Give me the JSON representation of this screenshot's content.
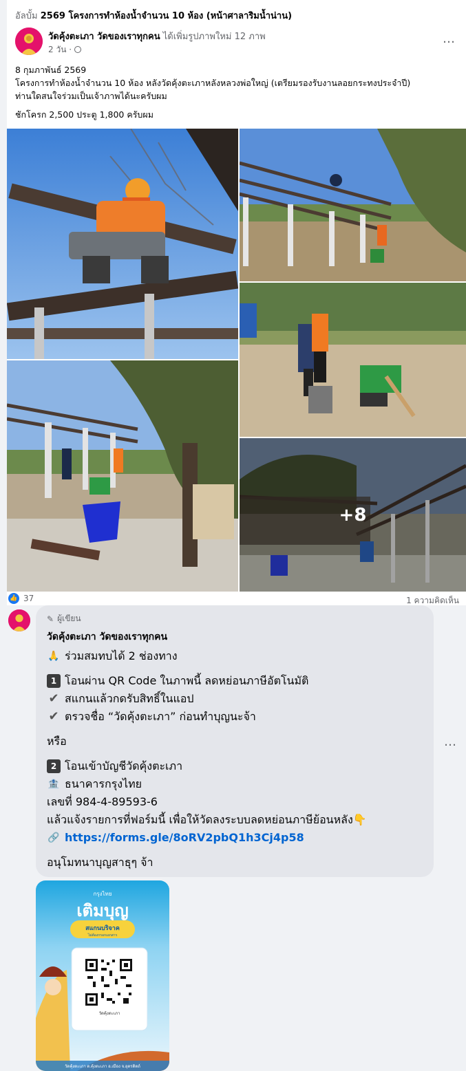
{
  "post": {
    "album_prefix": "อัลบั้ม",
    "album_title": "2569 โครงการทำห้องน้ำจำนวน 10 ห้อง (หน้าศาลาริมน้ำน่าน)",
    "author": "วัดคุ้งตะเภา วัดของเราทุกคน",
    "action": "ได้เพิ่มรูปภาพใหม่ 12 ภาพ",
    "time": "2 วัน ·",
    "more_icon": "…",
    "date_line": "8 กุมภาพันธ์ 2569",
    "line1": "โครงการทำห้องน้ำจำนวน 10 ห้อง หลังวัดคุ้งตะเภาหลังหลวงพ่อใหญ่ (เตรียมรองรับงานลอยกระทงประจำปี)",
    "line2": "ท่านใดสนใจร่วมเป็นเจ้าภาพได้นะครับผม",
    "line3": "ชักโครก 2,500 ประตู 1,800 ครับผม",
    "more_photos": "+8",
    "reaction_count": "37",
    "comment_count": "1 ความคิดเห็น"
  },
  "comment": {
    "badge": "ผู้เขียน",
    "author": "วัดคุ้งตะเภา วัดของเราทุกคน",
    "l1": "ร่วมสมทบได้ 2 ช่องทาง",
    "l2": "โอนผ่าน QR Code ในภาพนี้ ลดหย่อนภาษีอัตโนมัติ",
    "l3": "สแกนแล้วกดรับสิทธิ์ในแอป",
    "l4": "ตรวจชื่อ “วัดคุ้งตะเภา” ก่อนทำบุญนะจ้า",
    "l5": "หรือ",
    "l6": "โอนเข้าบัญชีวัดคุ้งตะเภา",
    "l7": "ธนาคารกรุงไทย",
    "l8": "เลขที่ 984-4-89593-6",
    "l9": "แล้วแจ้งรายการที่ฟอร์มนี้ เพื่อให้วัดลงระบบลดหย่อนภาษีย้อนหลัง👇",
    "l10": "https://forms.gle/8oRV2pbQ1h3Cj4p58",
    "l11": "อนุโมทนาบุญสาธุๆ จ้า",
    "key1": "1",
    "key2": "2",
    "icons": [
      "pray-icon",
      "check-icon",
      "bank-icon",
      "link-icon",
      "pencil-icon"
    ]
  },
  "qr_card": {
    "brand": "กรุงไทย",
    "title": "เติมบุญ",
    "subtitle": "สแกนบริจาค",
    "sub2": "ไม่ต้องกรอกเอกสาร",
    "receiver": "วัดคุ้งตะเภา",
    "footer": "วัดคุ้งตะเภา ต.คุ้งตะเภา อ.เมือง จ.อุตรดิตถ์"
  },
  "colors": {
    "link": "#0064d1",
    "brand_blue": "#1877f2",
    "bubble": "#e4e6eb"
  }
}
